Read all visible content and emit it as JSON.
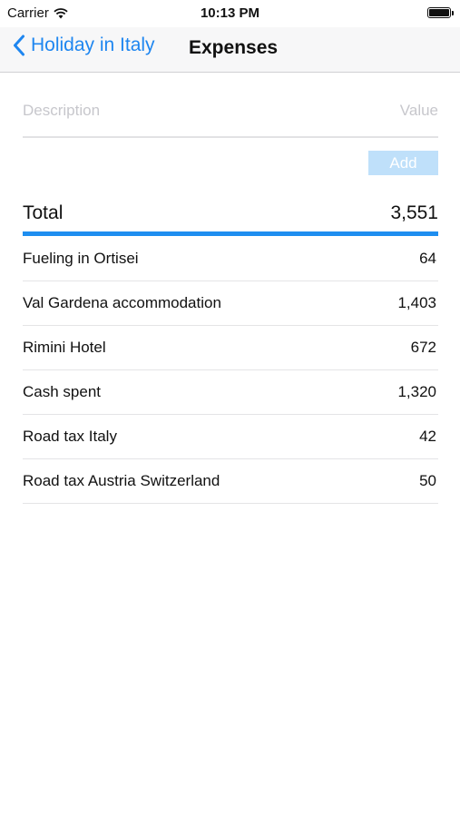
{
  "status_bar": {
    "carrier": "Carrier",
    "time": "10:13 PM"
  },
  "nav": {
    "back_label": "Holiday in Italy",
    "title": "Expenses"
  },
  "form": {
    "description_placeholder": "Description",
    "value_placeholder": "Value",
    "add_label": "Add"
  },
  "total": {
    "label": "Total",
    "value": "3,551"
  },
  "expenses": [
    {
      "description": "Fueling in Ortisei",
      "value": "64"
    },
    {
      "description": "Val Gardena accommodation",
      "value": "1,403"
    },
    {
      "description": "Rimini Hotel",
      "value": "672"
    },
    {
      "description": "Cash spent",
      "value": "1,320"
    },
    {
      "description": "Road tax Italy",
      "value": "42"
    },
    {
      "description": "Road tax Austria Switzerland",
      "value": "50"
    }
  ],
  "colors": {
    "accent": "#1e86f0",
    "add_button_bg": "#bfe0fa",
    "total_underline": "#1e8ef0"
  },
  "icons": {
    "wifi": "wifi-icon",
    "battery": "battery-icon",
    "back": "chevron-left-icon"
  }
}
